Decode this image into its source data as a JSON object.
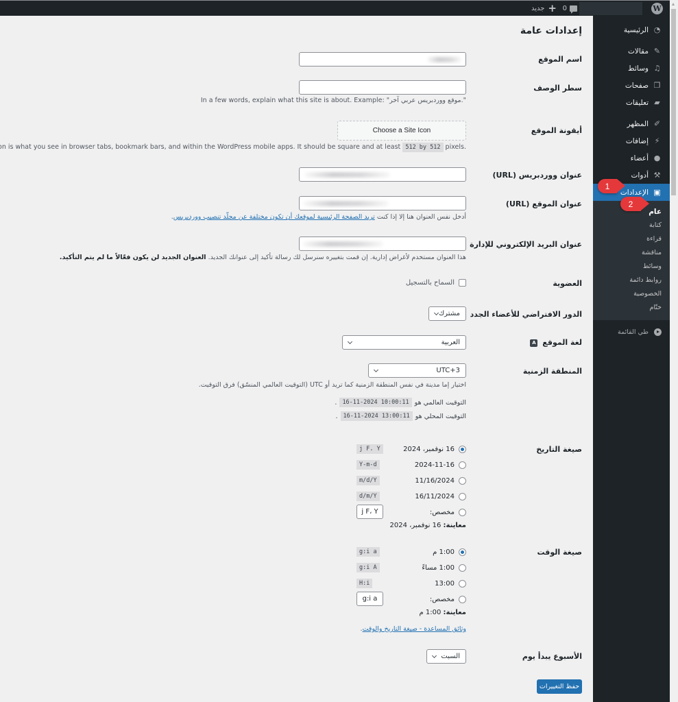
{
  "adminbar": {
    "logo_icon": "wordpress-logo-icon",
    "comments_count": "0",
    "new_label": "جديد"
  },
  "sidebar": {
    "items": [
      {
        "label": "الرئيسية",
        "icon": "dashboard-icon"
      },
      {
        "label": "مقالات",
        "icon": "pin-icon"
      },
      {
        "label": "وسائط",
        "icon": "media-icon"
      },
      {
        "label": "صفحات",
        "icon": "pages-icon"
      },
      {
        "label": "تعليقات",
        "icon": "comment-icon"
      },
      {
        "label": "المظهر",
        "icon": "brush-icon"
      },
      {
        "label": "إضافات",
        "icon": "plugin-icon"
      },
      {
        "label": "أعضاء",
        "icon": "user-icon"
      },
      {
        "label": "أدوات",
        "icon": "wrench-icon"
      },
      {
        "label": "الإعدادات",
        "icon": "settings-icon",
        "active": true
      }
    ],
    "submenu": [
      "عام",
      "كتابة",
      "قراءة",
      "مناقشة",
      "وسائط",
      "روابط دائمة",
      "الخصوصية",
      "ختّام"
    ],
    "collapse_label": "طي القائمة"
  },
  "callouts": {
    "first": "1",
    "second": "2"
  },
  "page": {
    "title": "إعدادات عامة",
    "site_title": {
      "label": "اسم الموقع"
    },
    "tagline": {
      "label": "سطر الوصف",
      "value": "",
      "description": "In a few words, explain what this site is about. Example: \"موقع ووردبريس عربي آخر.\""
    },
    "site_icon": {
      "label": "أيقونة الموقع",
      "button": "Choose a Site Icon",
      "description_before": "The Site Icon is what you see in browser tabs, bookmark bars, and within the WordPress mobile apps. It should be square and at least",
      "size_code": "512 by 512",
      "description_after": "pixels."
    },
    "wp_url": {
      "label": "عنوان ووردبريس (URL)"
    },
    "site_url": {
      "label": "عنوان الموقع (URL)",
      "desc_prefix": "أدخل نفس العنوان هنا إلا إذا كنت",
      "desc_link": "تريد الصفحة الرئيسية لموقعك أن تكون مختلفة عن مجلّد تنصيب ووردبريس"
    },
    "admin_email": {
      "label": "عنوان البريد الإلكتروني للإدارة",
      "desc": "هذا العنوان مستخدم لأغراض إدارية. إن قمت بتغييره سنرسل لك رسالة تأكيد إلى عنوانك الجديد.",
      "desc_bold": "العنوان الجديد لن يكون فعّالاً ما لم يتم التأكيد."
    },
    "membership": {
      "label": "العضوية",
      "checkbox_label": "السماح بالتسجيل",
      "checked": false
    },
    "default_role": {
      "label": "الدور الافتراضي للأعضاء الجدد",
      "value": "مشترك"
    },
    "language": {
      "label": "لغة الموقع",
      "icon": "translation-icon",
      "value": "العربية"
    },
    "timezone": {
      "label": "المنطقة الزمنية",
      "value": "UTC+3",
      "desc": "اختيار إما مدينة في نفس المنطقة الزمنية كما تريد أو UTC (التوقيت العالمي المنسّق) فرق التوقيت.",
      "utc_label": "التوقيت العالمي هو",
      "utc_value": "16-11-2024 10:00:11",
      "local_label": "التوقيت المحلي هو",
      "local_value": "16-11-2024 13:00:11"
    },
    "date_format": {
      "label": "صيغة التاريخ",
      "options": [
        {
          "label": "16 نوفمبر، 2024",
          "code": "j F، Y",
          "checked": true
        },
        {
          "label": "2024-11-16",
          "code": "Y-m-d",
          "checked": false
        },
        {
          "label": "11/16/2024",
          "code": "m/d/Y",
          "checked": false
        },
        {
          "label": "16/11/2024",
          "code": "d/m/Y",
          "checked": false
        }
      ],
      "custom_label": "مخصص:",
      "custom_value": "j F، Y",
      "preview_label": "معاينة:",
      "preview_value": "16 نوفمبر، 2024"
    },
    "time_format": {
      "label": "صيغة الوقت",
      "options": [
        {
          "label": "1:00 م",
          "code": "g:i a",
          "checked": true
        },
        {
          "label": "1:00 مساءً",
          "code": "g:i A",
          "checked": false
        },
        {
          "label": "13:00",
          "code": "H:i",
          "checked": false
        }
      ],
      "custom_label": "مخصص:",
      "custom_value": "g:i a",
      "preview_label": "معاينة:",
      "preview_value": "1:00 م",
      "doc_link": "وثائق المساعدة - صيغة التاريخ والوقت"
    },
    "week_start": {
      "label": "الأسبوع يبدأ يوم",
      "value": "السبت"
    },
    "save_button": "حفظ التغييرات"
  }
}
